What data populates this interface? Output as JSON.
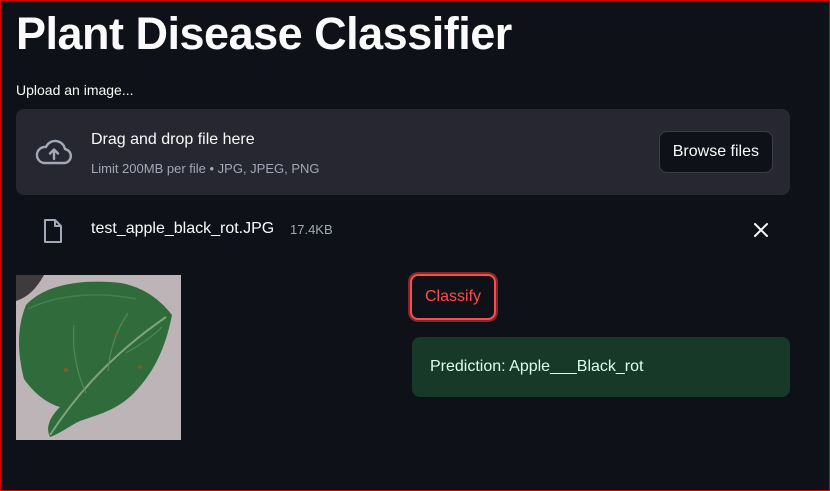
{
  "app": {
    "title": "Plant Disease Classifier"
  },
  "uploader": {
    "label": "Upload an image...",
    "dropzone_title": "Drag and drop file here",
    "limit_text": "Limit 200MB per file • JPG, JPEG, PNG",
    "browse_label": "Browse files",
    "icon": "cloud-upload-icon"
  },
  "uploaded_file": {
    "name": "test_apple_black_rot.JPG",
    "size": "17.4KB",
    "icon": "file-icon",
    "remove_icon": "close-icon"
  },
  "actions": {
    "classify_label": "Classify"
  },
  "result": {
    "prediction_text": "Prediction: Apple___Black_rot"
  },
  "colors": {
    "background": "#0e1117",
    "dropzone": "#262730",
    "accent": "#ff4b4b",
    "success_bg": "#173928",
    "success_text": "#dffde9"
  }
}
